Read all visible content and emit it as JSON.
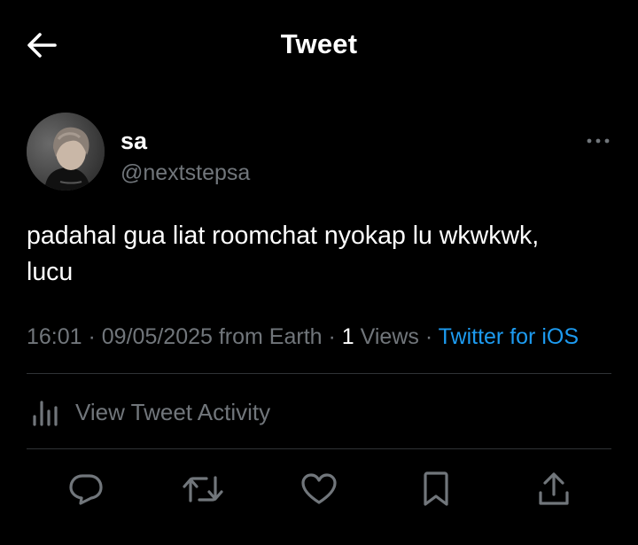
{
  "header": {
    "title": "Tweet",
    "back_icon": "arrow-left-icon"
  },
  "author": {
    "display_name": "sa",
    "handle": "@nextstepsa",
    "more_icon": "more-options-icon"
  },
  "tweet": {
    "text_line1": "padahal gua liat roomchat nyokap lu wkwkwk,",
    "text_line2": "lucu"
  },
  "meta": {
    "time": "16:01",
    "separator": " · ",
    "date": "09/05/2025",
    "location": " from Earth",
    "views_count": "1",
    "views_label": " Views",
    "source": "Twitter for iOS"
  },
  "activity": {
    "label": "View Tweet Activity",
    "icon": "analytics-bars-icon"
  },
  "actions": [
    {
      "name": "reply",
      "icon": "reply-icon"
    },
    {
      "name": "retweet",
      "icon": "retweet-icon"
    },
    {
      "name": "like",
      "icon": "heart-icon"
    },
    {
      "name": "bookmark",
      "icon": "bookmark-icon"
    },
    {
      "name": "share",
      "icon": "share-icon"
    }
  ],
  "colors": {
    "background": "#000000",
    "text": "#ffffff",
    "secondary": "#71767b",
    "link": "#1d9bf0",
    "divider": "#2f3336"
  }
}
